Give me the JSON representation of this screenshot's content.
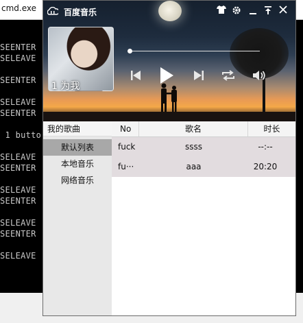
{
  "cmd": {
    "title": "cmd.exe",
    "lines": [
      "SEENTER",
      "SELEAVE",
      "SEENTER",
      "SELEAVE",
      "SEENTER",
      " 1 butto",
      "SELEAVE",
      "SEENTER",
      "SELEAVE",
      "SEENTER",
      "SELEAVE",
      "SEENTER",
      "SELEAVE"
    ]
  },
  "app": {
    "title": "百度音乐",
    "cover_caption": "1 为我",
    "progress": 0.0,
    "icons": {
      "logo": "cloud-music-icon",
      "skin": "tshirt-icon",
      "settings": "gear-icon",
      "minimize": "minimize-icon",
      "pin": "pin-icon",
      "close": "close-icon",
      "prev": "previous-track-icon",
      "play": "play-icon",
      "next": "next-track-icon",
      "repeat": "repeat-icon",
      "volume": "volume-icon"
    }
  },
  "sidebar": {
    "header": "我的歌曲",
    "items": [
      {
        "label": "默认列表",
        "active": true
      },
      {
        "label": "本地音乐",
        "active": false
      },
      {
        "label": "网络音乐",
        "active": false
      }
    ]
  },
  "table": {
    "columns": [
      "No",
      "歌名",
      "时长"
    ],
    "rows": [
      {
        "no": "fuck",
        "name": "ssss",
        "duration": "--:--"
      },
      {
        "no": "fu···",
        "name": "aaa",
        "duration": "20:20"
      }
    ]
  }
}
